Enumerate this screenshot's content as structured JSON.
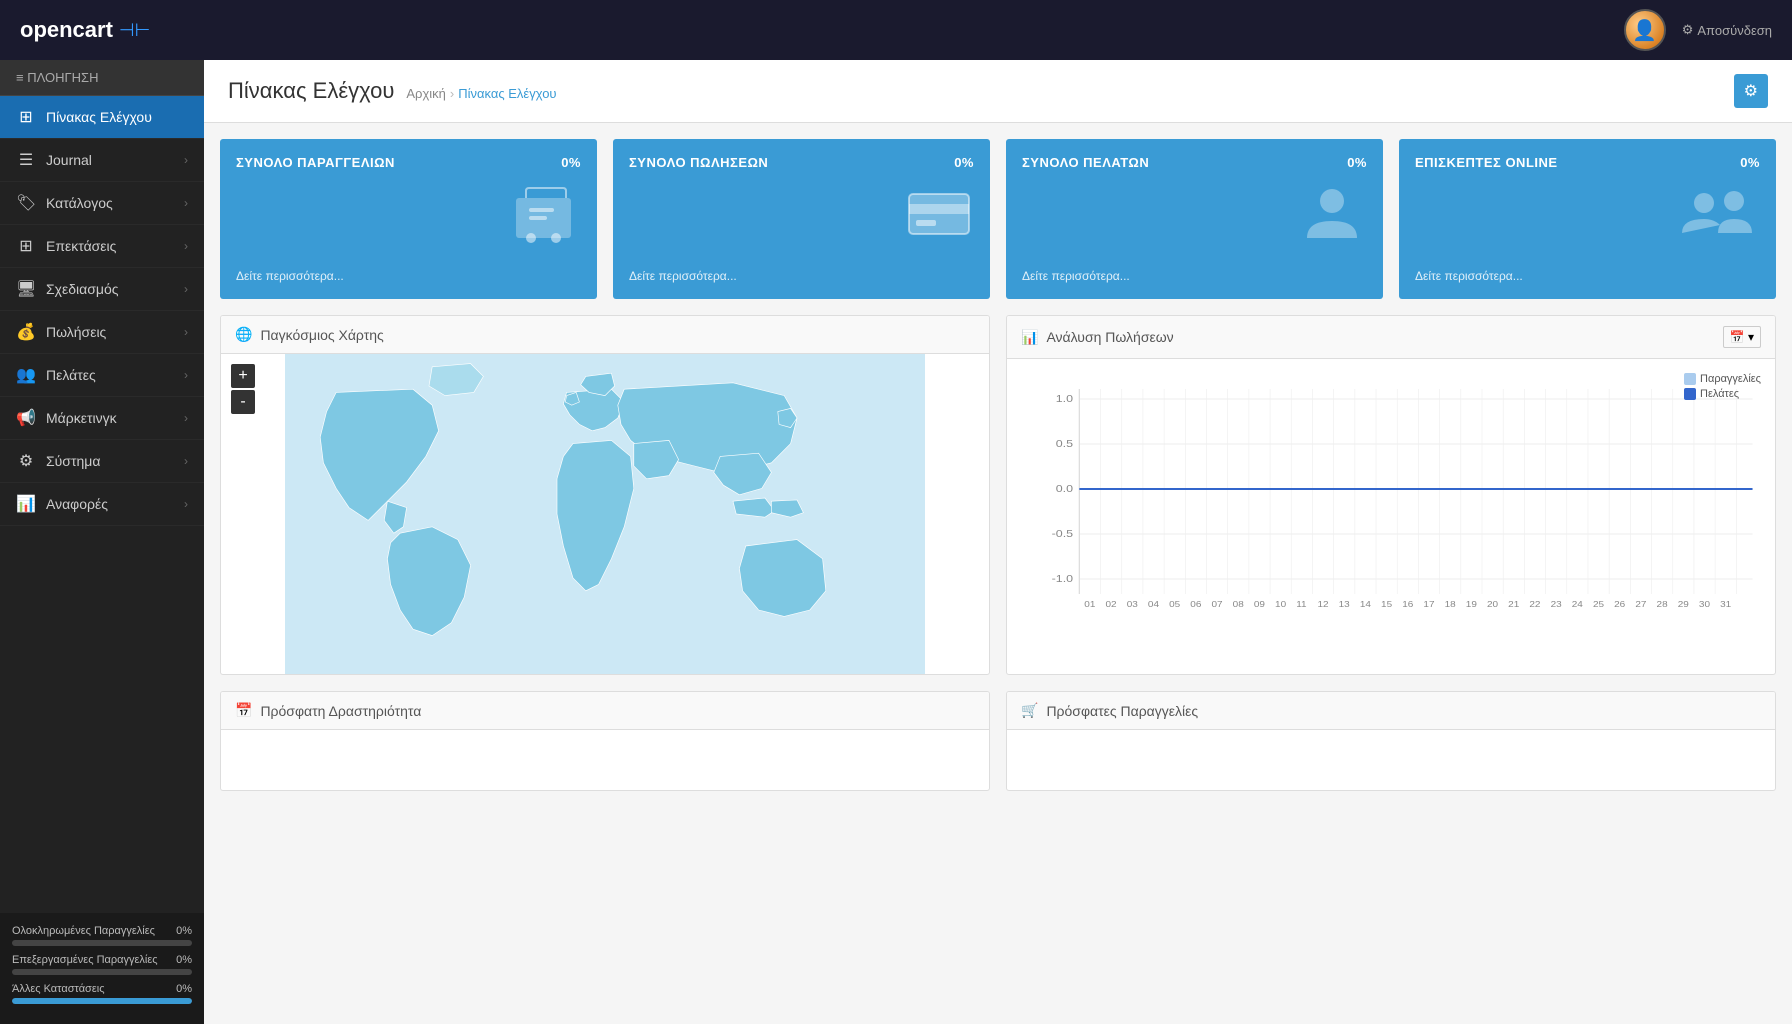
{
  "topnav": {
    "logo_text": "opencart",
    "logo_cart_icon": "🛒",
    "logout_icon": "⚙",
    "logout_label": "Αποσύνδεση",
    "avatar_icon": "👤"
  },
  "sidebar": {
    "nav_header": "≡ ΠΛΟΗΓΗΣΗ",
    "items": [
      {
        "id": "dashboard",
        "icon": "⊞",
        "label": "Πίνακας Ελέγχου",
        "has_arrow": false,
        "active": true
      },
      {
        "id": "journal",
        "icon": "☰",
        "label": "Journal",
        "has_arrow": true,
        "active": false
      },
      {
        "id": "catalog",
        "icon": "🏷",
        "label": "Κατάλογος",
        "has_arrow": true,
        "active": false
      },
      {
        "id": "extensions",
        "icon": "⊞",
        "label": "Επεκτάσεις",
        "has_arrow": true,
        "active": false
      },
      {
        "id": "design",
        "icon": "🖥",
        "label": "Σχεδιασμός",
        "has_arrow": true,
        "active": false
      },
      {
        "id": "sales",
        "icon": "💰",
        "label": "Πωλήσεις",
        "has_arrow": true,
        "active": false
      },
      {
        "id": "customers",
        "icon": "👥",
        "label": "Πελάτες",
        "has_arrow": true,
        "active": false
      },
      {
        "id": "marketing",
        "icon": "📢",
        "label": "Μάρκετινγκ",
        "has_arrow": true,
        "active": false
      },
      {
        "id": "system",
        "icon": "⚙",
        "label": "Σύστημα",
        "has_arrow": true,
        "active": false
      },
      {
        "id": "reports",
        "icon": "📊",
        "label": "Αναφορές",
        "has_arrow": true,
        "active": false
      }
    ],
    "progress_items": [
      {
        "label": "Ολοκληρωμένες Παραγγελίες",
        "value": "0%",
        "fill": 0
      },
      {
        "label": "Επεξεργασμένες Παραγγελίες",
        "value": "0%",
        "fill": 0
      },
      {
        "label": "Άλλες Καταστάσεις",
        "value": "0%",
        "fill": 100
      }
    ]
  },
  "breadcrumb": {
    "home": "Αρχική",
    "current": "Πίνακας Ελέγχου"
  },
  "page_title": "Πίνακας Ελέγχου",
  "settings_icon": "⚙",
  "stat_cards": [
    {
      "title": "ΣΥΝΟΛΟ ΠΑΡΑΓΓΕΛΙΩΝ",
      "percent": "0%",
      "icon": "🛒",
      "link": "Δείτε περισσότερα..."
    },
    {
      "title": "ΣΥΝΟΛΟ ΠΩΛΗΣΕΩΝ",
      "percent": "0%",
      "icon": "💳",
      "link": "Δείτε περισσότερα..."
    },
    {
      "title": "ΣΥΝΟΛΟ ΠΕΛΑΤΩΝ",
      "percent": "0%",
      "icon": "👤",
      "link": "Δείτε περισσότερα..."
    },
    {
      "title": "ΕΠΙΣΚΕΠΤΕΣ ONLINE",
      "percent": "0%",
      "icon": "👥",
      "link": "Δείτε περισσότερα..."
    }
  ],
  "world_map": {
    "title": "Παγκόσμιος Χάρτης",
    "icon": "🌐",
    "zoom_in": "+",
    "zoom_out": "-"
  },
  "sales_chart": {
    "title": "Ανάλυση Πωλήσεων",
    "icon": "📊",
    "calendar_icon": "📅",
    "legend": [
      {
        "label": "Παραγγελίες",
        "color": "#aaccee"
      },
      {
        "label": "Πελάτες",
        "color": "#3366cc"
      }
    ],
    "y_axis": [
      "1.0",
      "0.5",
      "0.0",
      "-0.5",
      "-1.0"
    ],
    "x_axis": [
      "01",
      "02",
      "03",
      "04",
      "05",
      "06",
      "07",
      "08",
      "09",
      "10",
      "11",
      "12",
      "13",
      "14",
      "15",
      "16",
      "17",
      "18",
      "19",
      "20",
      "21",
      "22",
      "23",
      "24",
      "25",
      "26",
      "27",
      "28",
      "29",
      "30",
      "31"
    ]
  },
  "recent_activity": {
    "title": "Πρόσφατη Δραστηριότητα",
    "icon": "📅"
  },
  "recent_orders": {
    "title": "Πρόσφατες Παραγγελίες",
    "icon": "🛒"
  }
}
